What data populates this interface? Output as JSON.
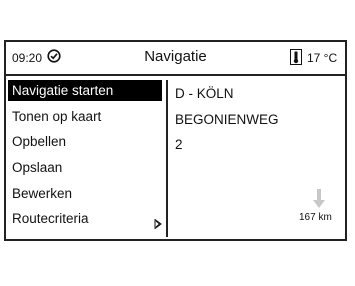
{
  "statusbar": {
    "time": "09:20",
    "title": "Navigatie",
    "temperature": "17 °C",
    "clock_icon": "clock-check-icon",
    "thermometer_icon": "thermometer-icon"
  },
  "menu": {
    "items": [
      {
        "label": "Navigatie starten",
        "selected": true
      },
      {
        "label": "Tonen op kaart"
      },
      {
        "label": "Opbellen"
      },
      {
        "label": "Opslaan"
      },
      {
        "label": "Bewerken"
      },
      {
        "label": "Routecriteria",
        "has_submenu": true
      }
    ]
  },
  "destination": {
    "city": "D - KÖLN",
    "street": "BEGONIENWEG",
    "number": "2",
    "distance": "167 km",
    "direction_icon": "arrow-down-icon"
  },
  "colors": {
    "selection_background": "#000000",
    "selection_text": "#ffffff",
    "border": "#222222",
    "icon_grey": "#c8c8c8"
  }
}
